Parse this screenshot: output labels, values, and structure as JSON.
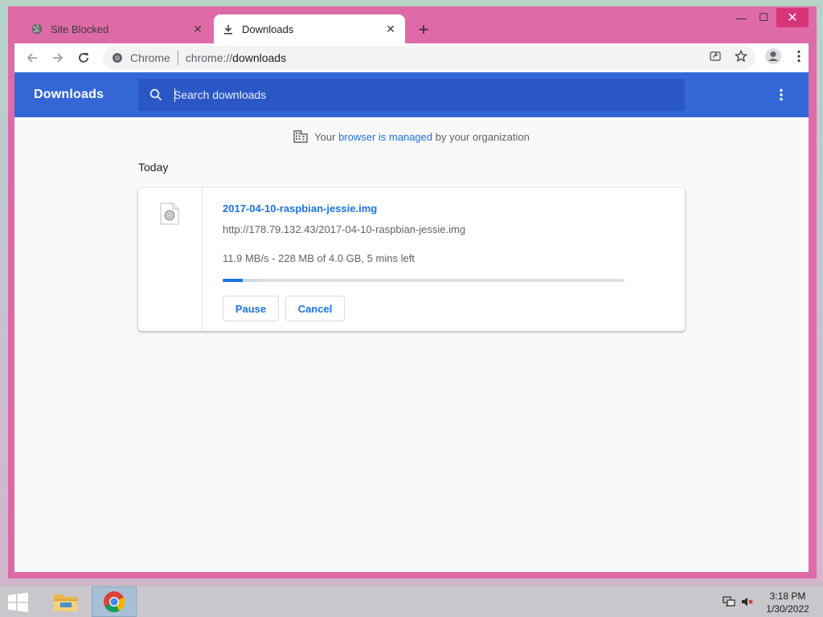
{
  "window": {
    "tabs": [
      {
        "title": "Site Blocked",
        "active": false
      },
      {
        "title": "Downloads",
        "active": true
      }
    ],
    "controls": {
      "minimize": "—",
      "maximize": "☐",
      "close": "✕"
    }
  },
  "toolbar": {
    "omnibox_chip": "Chrome",
    "url_scheme": "chrome://",
    "url_host": "downloads"
  },
  "downloads": {
    "title": "Downloads",
    "search_placeholder": "Search downloads",
    "managed_prefix": "Your ",
    "managed_link": "browser is managed",
    "managed_suffix": " by your organization",
    "date_header": "Today",
    "items": [
      {
        "file_name": "2017-04-10-raspbian-jessie.img",
        "url": "http://178.79.132.43/2017-04-10-raspbian-jessie.img",
        "status": "11.9 MB/s - 228 MB of 4.0 GB, 5 mins left",
        "progress_fraction": 0.05,
        "buttons": {
          "pause": "Pause",
          "cancel": "Cancel"
        }
      }
    ]
  },
  "taskbar": {
    "time": "3:18 PM",
    "date": "1/30/2022"
  },
  "colors": {
    "window_frame": "#de6aa7",
    "header_blue": "#3367d6",
    "accent_blue": "#1a73e8"
  }
}
